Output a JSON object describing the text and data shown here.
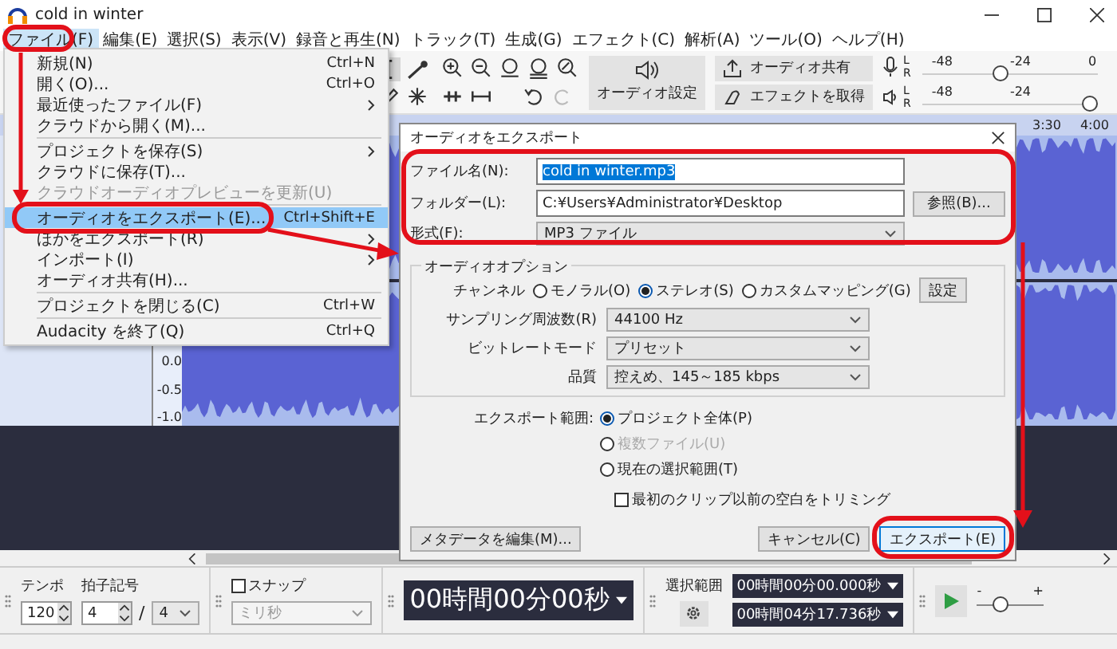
{
  "window": {
    "title": "cold in winter"
  },
  "menu_bar": [
    {
      "label": "ファイル(F)",
      "selected": true
    },
    {
      "label": "編集(E)",
      "selected": false
    },
    {
      "label": "選択(S)",
      "selected": false
    },
    {
      "label": "表示(V)",
      "selected": false
    },
    {
      "label": "録音と再生(N)",
      "selected": false
    },
    {
      "label": "トラック(T)",
      "selected": false
    },
    {
      "label": "生成(G)",
      "selected": false
    },
    {
      "label": "エフェクト(C)",
      "selected": false
    },
    {
      "label": "解析(A)",
      "selected": false
    },
    {
      "label": "ツール(O)",
      "selected": false
    },
    {
      "label": "ヘルプ(H)",
      "selected": false
    }
  ],
  "toolbar": {
    "audio_setup_label": "オーディオ設定",
    "share_audio_label": "オーディオ共有",
    "get_effects_label": "エフェクトを取得",
    "record_meter": {
      "channels": [
        "L",
        "R"
      ],
      "ticks": [
        "-48",
        "-24",
        "0"
      ],
      "level": 0.44
    },
    "playback_meter": {
      "channels": [
        "L",
        "R"
      ],
      "ticks": [
        "-48",
        "-24"
      ],
      "level": 1.0
    }
  },
  "timeline": {
    "ticks": [
      "3:30",
      "4:00"
    ]
  },
  "track": {
    "scale": [
      "0.0",
      "-0.5",
      "-1.0"
    ]
  },
  "file_menu": {
    "groups": [
      [
        {
          "label": "新規(N)",
          "shortcut": "Ctrl+N",
          "submenu": false,
          "disabled": false,
          "selected": false
        },
        {
          "label": "開く(O)...",
          "shortcut": "Ctrl+O",
          "submenu": false,
          "disabled": false,
          "selected": false
        },
        {
          "label": "最近使ったファイル(F)",
          "submenu": true,
          "disabled": false,
          "selected": false
        },
        {
          "label": "クラウドから開く(M)...",
          "submenu": false,
          "disabled": false,
          "selected": false
        }
      ],
      [
        {
          "label": "プロジェクトを保存(S)",
          "submenu": true,
          "disabled": false,
          "selected": false
        },
        {
          "label": "クラウドに保存(T)...",
          "submenu": false,
          "disabled": false,
          "selected": false
        },
        {
          "label": "クラウドオーディオプレビューを更新(U)",
          "submenu": false,
          "disabled": true,
          "selected": false
        }
      ],
      [
        {
          "label": "オーディオをエクスポート(E)...",
          "shortcut": "Ctrl+Shift+E",
          "submenu": false,
          "disabled": false,
          "selected": true
        },
        {
          "label": "ほかをエクスポート(R)",
          "submenu": true,
          "disabled": false,
          "selected": false
        },
        {
          "label": "インポート(I)",
          "submenu": true,
          "disabled": false,
          "selected": false
        },
        {
          "label": "オーディオ共有(H)...",
          "submenu": false,
          "disabled": false,
          "selected": false
        }
      ],
      [
        {
          "label": "プロジェクトを閉じる(C)",
          "shortcut": "Ctrl+W",
          "submenu": false,
          "disabled": false,
          "selected": false
        }
      ],
      [
        {
          "label": "Audacity を終了(Q)",
          "shortcut": "Ctrl+Q",
          "submenu": false,
          "disabled": false,
          "selected": false
        }
      ]
    ]
  },
  "export_dialog": {
    "title": "オーディオをエクスポート",
    "file_name": {
      "label": "ファイル名(N):",
      "value": "cold in winter.mp3",
      "text_selected": true
    },
    "folder": {
      "label": "フォルダー(L):",
      "value": "C:¥Users¥Administrator¥Desktop",
      "browse_button": "参照(B)..."
    },
    "format": {
      "label": "形式(F):",
      "value": "MP3 ファイル"
    },
    "audio_options": {
      "title": "オーディオオプション",
      "channel": {
        "label": "チャンネル",
        "options": [
          {
            "label": "モノラル(O)",
            "selected": false
          },
          {
            "label": "ステレオ(S)",
            "selected": true
          },
          {
            "label": "カスタムマッピング(G)",
            "selected": false
          }
        ],
        "settings_button": "設定"
      },
      "fields": [
        {
          "label": "サンプリング周波数(R)",
          "value": "44100 Hz"
        },
        {
          "label": "ビットレートモード",
          "value": "プリセット"
        },
        {
          "label": "品質",
          "value": "控えめ、145～185 kbps"
        }
      ]
    },
    "export_range": {
      "label": "エクスポート範囲:",
      "options": [
        {
          "label": "プロジェクト全体(P)",
          "selected": true,
          "disabled": false
        },
        {
          "label": "複数ファイル(U)",
          "selected": false,
          "disabled": true
        },
        {
          "label": "現在の選択範囲(T)",
          "selected": false,
          "disabled": false
        }
      ]
    },
    "trim": {
      "label": "最初のクリップ以前の空白をトリミング",
      "checked": false
    },
    "buttons": [
      {
        "label": "メタデータを編集(M)...",
        "default": false
      },
      {
        "label": "キャンセル(C)",
        "default": false
      },
      {
        "label": "エクスポート(E)",
        "default": true
      }
    ]
  },
  "bottom_toolbar": {
    "tempo": {
      "label": "テンポ",
      "value": "120"
    },
    "time_signature": {
      "label": "拍子記号",
      "beats": "4",
      "separator": "/",
      "unit": "4"
    },
    "snap": {
      "label": "スナップ",
      "checked": false,
      "unit": "ミリ秒",
      "unit_disabled": true
    },
    "time_display": "00時間00分00秒",
    "selection": {
      "label": "選択範囲",
      "start": "00時間00分00.000秒",
      "end": "00時間04分17.736秒"
    },
    "play_speed": {
      "min_mark": "-",
      "max_mark": "+",
      "level": 0.32
    }
  }
}
